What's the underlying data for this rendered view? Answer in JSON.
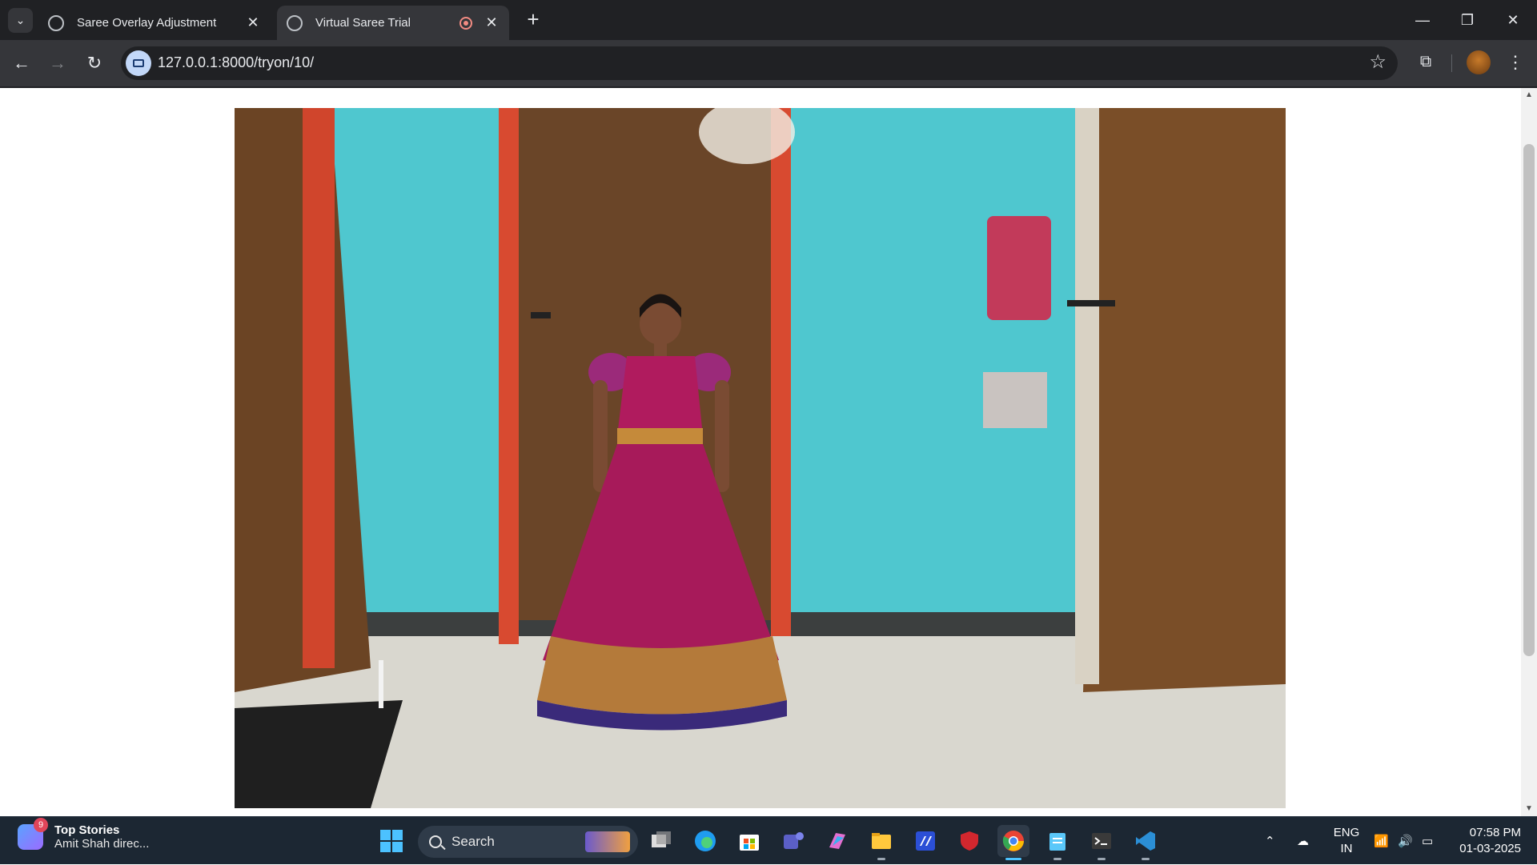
{
  "browser": {
    "tabs": [
      {
        "title": "Saree Overlay Adjustment",
        "active": false
      },
      {
        "title": "Virtual Saree Trial",
        "active": true,
        "recording": true
      }
    ],
    "url": "127.0.0.1:8000/tryon/10/"
  },
  "page": {
    "video_feed_alt": "Live camera feed with virtual saree overlay"
  },
  "taskbar": {
    "news": {
      "badge": "9",
      "title": "Top Stories",
      "headline": "Amit Shah direc..."
    },
    "search_placeholder": "Search",
    "language": {
      "line1": "ENG",
      "line2": "IN"
    },
    "time": "07:58 PM",
    "date": "01-03-2025"
  },
  "colors": {
    "chrome_dark": "#202124",
    "chrome_toolbar": "#35363a",
    "taskbar": "#1c2733",
    "recording": "#f28b82",
    "accent": "#4cc2ff"
  }
}
